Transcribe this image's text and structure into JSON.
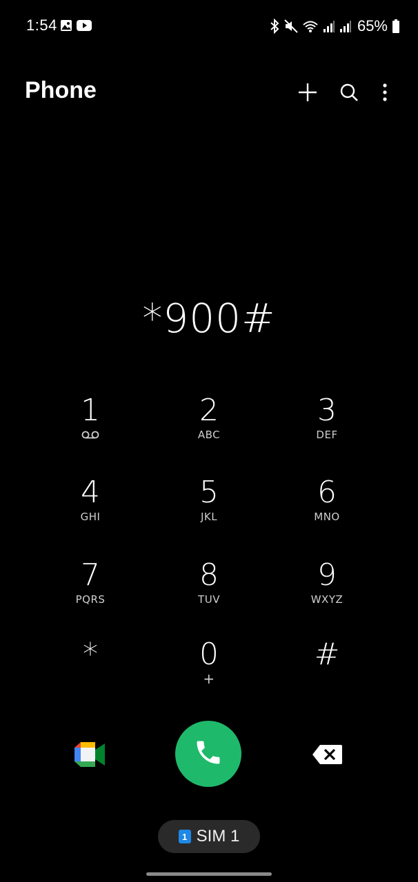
{
  "status_bar": {
    "time": "1:54",
    "battery_percent": "65%",
    "left_icons": [
      "gallery-icon",
      "youtube-icon"
    ],
    "right_icons": [
      "bluetooth-icon",
      "mute-icon",
      "wifi-icon",
      "signal-icon",
      "signal-icon",
      "battery-icon"
    ]
  },
  "app_bar": {
    "title": "Phone",
    "actions": [
      "add-icon",
      "search-icon",
      "more-options-icon"
    ]
  },
  "dialer": {
    "number": "*900#"
  },
  "keypad": {
    "keys": [
      {
        "digit": "1",
        "letters": "",
        "sub_icon": "voicemail-icon"
      },
      {
        "digit": "2",
        "letters": "ABC"
      },
      {
        "digit": "3",
        "letters": "DEF"
      },
      {
        "digit": "4",
        "letters": "GHI"
      },
      {
        "digit": "5",
        "letters": "JKL"
      },
      {
        "digit": "6",
        "letters": "MNO"
      },
      {
        "digit": "7",
        "letters": "PQRS"
      },
      {
        "digit": "8",
        "letters": "TUV"
      },
      {
        "digit": "9",
        "letters": "WXYZ"
      },
      {
        "digit": "*",
        "letters": ""
      },
      {
        "digit": "0",
        "letters": "+"
      },
      {
        "digit": "#",
        "letters": ""
      }
    ]
  },
  "controls": {
    "video_call_icon": "google-meet-icon",
    "call_icon": "phone-icon",
    "backspace_icon": "backspace-icon"
  },
  "sim": {
    "badge": "1",
    "label": "SIM 1"
  },
  "colors": {
    "background": "#000000",
    "call_green": "#1fb96b",
    "sim_badge_blue": "#1e88e5",
    "pill_bg": "#2a2a2a"
  }
}
